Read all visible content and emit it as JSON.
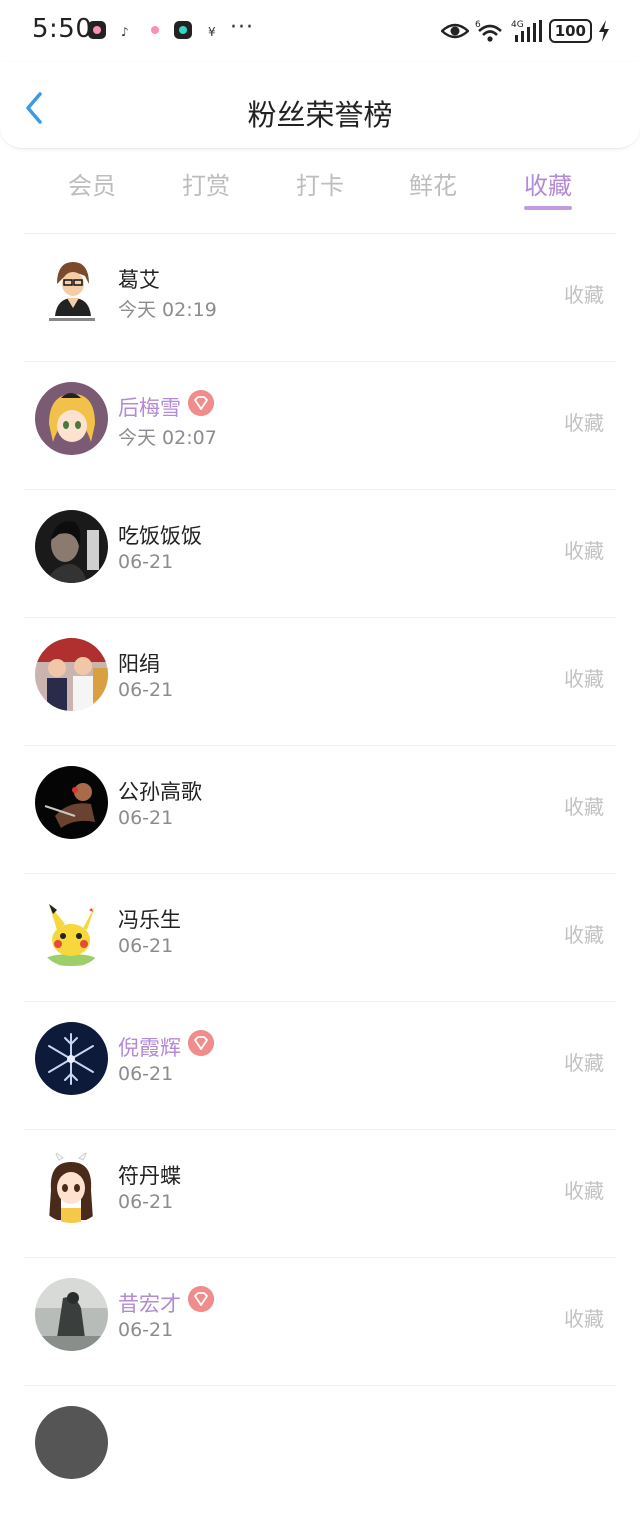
{
  "status_bar": {
    "time": "5:50",
    "ellipsis": "···",
    "signal_labels": [
      "6",
      "4G"
    ],
    "battery": "100",
    "icons": [
      "eye-icon",
      "wifi-icon",
      "signal-icon",
      "battery-icon",
      "charging-icon"
    ]
  },
  "header": {
    "title": "粉丝荣誉榜",
    "back_icon": "chevron-left-icon"
  },
  "tabs": [
    {
      "label": "会员",
      "active": false
    },
    {
      "label": "打赏",
      "active": false
    },
    {
      "label": "打卡",
      "active": false
    },
    {
      "label": "鲜花",
      "active": false
    },
    {
      "label": "收藏",
      "active": true
    }
  ],
  "fans": [
    {
      "name": "葛艾",
      "time": "今天 02:19",
      "vip": false,
      "action": "收藏"
    },
    {
      "name": "后梅雪",
      "time": "今天 02:07",
      "vip": true,
      "action": "收藏"
    },
    {
      "name": "吃饭饭饭",
      "time": "06-21",
      "vip": false,
      "action": "收藏"
    },
    {
      "name": "阳绢",
      "time": "06-21",
      "vip": false,
      "action": "收藏"
    },
    {
      "name": "公孙高歌",
      "time": "06-21",
      "vip": false,
      "action": "收藏"
    },
    {
      "name": "冯乐生",
      "time": "06-21",
      "vip": false,
      "action": "收藏"
    },
    {
      "name": "倪霞辉",
      "time": "06-21",
      "vip": true,
      "action": "收藏"
    },
    {
      "name": "符丹蝶",
      "time": "06-21",
      "vip": false,
      "action": "收藏"
    },
    {
      "name": "昔宏才",
      "time": "06-21",
      "vip": true,
      "action": "收藏"
    }
  ],
  "colors": {
    "accent": "#b38ad6",
    "tab_inactive": "#bdbdbd",
    "badge": "#f08c8c",
    "secondary_text": "#8c8c8c",
    "back_arrow": "#3a9be8"
  }
}
